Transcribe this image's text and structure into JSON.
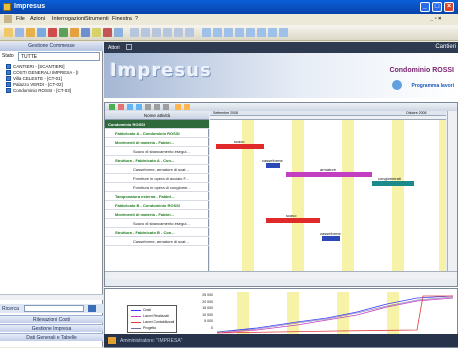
{
  "app": {
    "title": "Impresus"
  },
  "menu": [
    "File",
    "Azioni",
    "Interrogazioni",
    "Strumenti",
    "Finestra",
    "?"
  ],
  "sidebar": {
    "header": "Gestione Commesse",
    "state_label": "Stato",
    "state_value": "TUTTE",
    "tree": [
      "CANTIERI - [SCANTIERI]",
      "COSTI GENERALI IMPRESA - [I",
      "Villa CELESTE - [CT-01]",
      "Palazzo VERDI - [CT-02]",
      "Condominio ROSSI - [CT-03]"
    ],
    "search_label": "Ricerca",
    "nav": [
      "Rilevazioni Costi",
      "Gestione Impresa",
      "Dati Generali e Tabelle"
    ]
  },
  "main": {
    "tab": "Attori",
    "tab_right": "Cantieri",
    "logo": "Impresus",
    "project_title": "Condominio ROSSI",
    "program_button": "Programma lavori"
  },
  "gantt": {
    "column_header": "Nome attività",
    "months": [
      "Settembre 2008",
      "Ottobre 2008"
    ],
    "rows": [
      {
        "label": "Condominio ROSSI",
        "type": "top"
      },
      {
        "label": "Fabbricato A - Condominio ROSSI",
        "type": "group"
      },
      {
        "label": "Movimenti di materia - Fabbri...",
        "type": "group"
      },
      {
        "label": "Scavo di sbancamento esegui...",
        "type": "task"
      },
      {
        "label": "Struttura - Fabbricato A - Con...",
        "type": "group"
      },
      {
        "label": "Casseforme, armature di scat...",
        "type": "task"
      },
      {
        "label": "Forniture in opera di acciaio F...",
        "type": "task"
      },
      {
        "label": "Fornitura in opera di conglome...",
        "type": "task"
      },
      {
        "label": "Tamponatura esterna - Fabbri...",
        "type": "group"
      },
      {
        "label": "Fabbricato B - Condominio ROSSI",
        "type": "group"
      },
      {
        "label": "Movimenti di materia - Fabbri...",
        "type": "group"
      },
      {
        "label": "Scavo di sbancamento esegui...",
        "type": "task"
      },
      {
        "label": "Struttura - Fabbricato B - Con...",
        "type": "group"
      },
      {
        "label": "Casseforme, armature di scat...",
        "type": "task"
      }
    ],
    "bar_labels": [
      "scavo",
      "casseforme",
      "armature",
      "conglomerati",
      "scavo",
      "casseforme"
    ]
  },
  "lower": {
    "y_ticks": [
      "25 000",
      "20 000",
      "15 000",
      "10 000",
      "5 000",
      "0"
    ],
    "legend": [
      "Costi",
      "Lavori Realizzati",
      "Lavori Contabilizzati",
      "Progetto"
    ],
    "colors": {
      "costi": "#3b3bff",
      "realizzati": "#c53fc5",
      "contabilizzati": "#e03c3c",
      "progetto": "#7070a0"
    }
  },
  "status": {
    "text": "Amministratore: \"IMPRESA\""
  }
}
